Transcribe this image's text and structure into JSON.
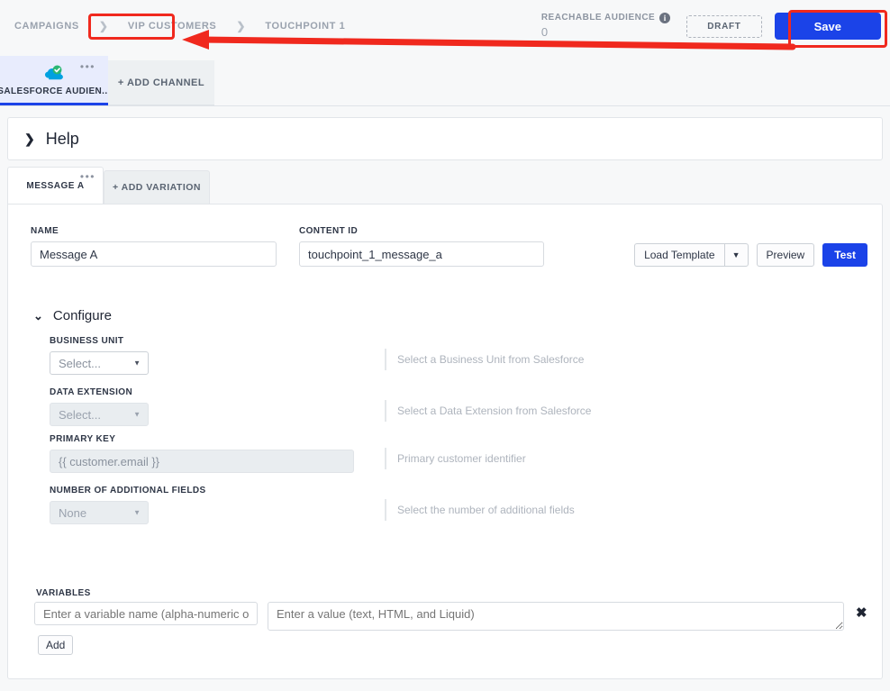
{
  "breadcrumb": {
    "items": [
      {
        "label": "CAMPAIGNS"
      },
      {
        "label": "VIP CUSTOMERS"
      },
      {
        "label": "TOUCHPOINT 1"
      }
    ],
    "separator": "❯"
  },
  "header": {
    "audience_label": "REACHABLE AUDIENCE",
    "audience_info_icon": "info-icon",
    "audience_count": "0",
    "status_badge": "DRAFT",
    "save_label": "Save"
  },
  "channels": {
    "active": {
      "label": "SALESFORCE AUDIEN...",
      "icon": "salesforce-cloud-check-icon",
      "menu": "•••"
    },
    "add_label": "+ ADD CHANNEL"
  },
  "help": {
    "chevron": "❯",
    "title": "Help"
  },
  "variations": {
    "active_label": "MESSAGE A",
    "menu": "•••",
    "add_label": "+ ADD VARIATION"
  },
  "message": {
    "name_label": "NAME",
    "name_value": "Message A",
    "content_id_label": "CONTENT ID",
    "content_id_value": "touchpoint_1_message_a",
    "load_template_label": "Load Template",
    "load_template_caret": "▼",
    "preview_label": "Preview",
    "test_label": "Test"
  },
  "configure": {
    "chevron": "⌄",
    "title": "Configure",
    "fields": [
      {
        "label": "BUSINESS UNIT",
        "value": "Select...",
        "control": "select",
        "disabled": false,
        "hint": "Select a Business Unit from Salesforce"
      },
      {
        "label": "DATA EXTENSION",
        "value": "Select...",
        "control": "select",
        "disabled": true,
        "hint": "Select a Data Extension from Salesforce"
      },
      {
        "label": "PRIMARY KEY",
        "value": "{{ customer.email }}",
        "control": "text",
        "disabled": true,
        "hint": "Primary customer identifier"
      },
      {
        "label": "NUMBER OF ADDITIONAL FIELDS",
        "value": "None",
        "control": "select",
        "disabled": true,
        "hint": "Select the number of additional fields"
      }
    ]
  },
  "variables": {
    "label": "VARIABLES",
    "name_placeholder": "Enter a variable name (alpha-numeric only)",
    "name_value": "",
    "value_placeholder": "Enter a value (text, HTML, and Liquid)",
    "value_value": "",
    "remove_icon": "✖",
    "add_label": "Add"
  },
  "annotation": {
    "color": "#f0291e",
    "targets": [
      "breadcrumb-vip-customers",
      "save-button"
    ]
  }
}
